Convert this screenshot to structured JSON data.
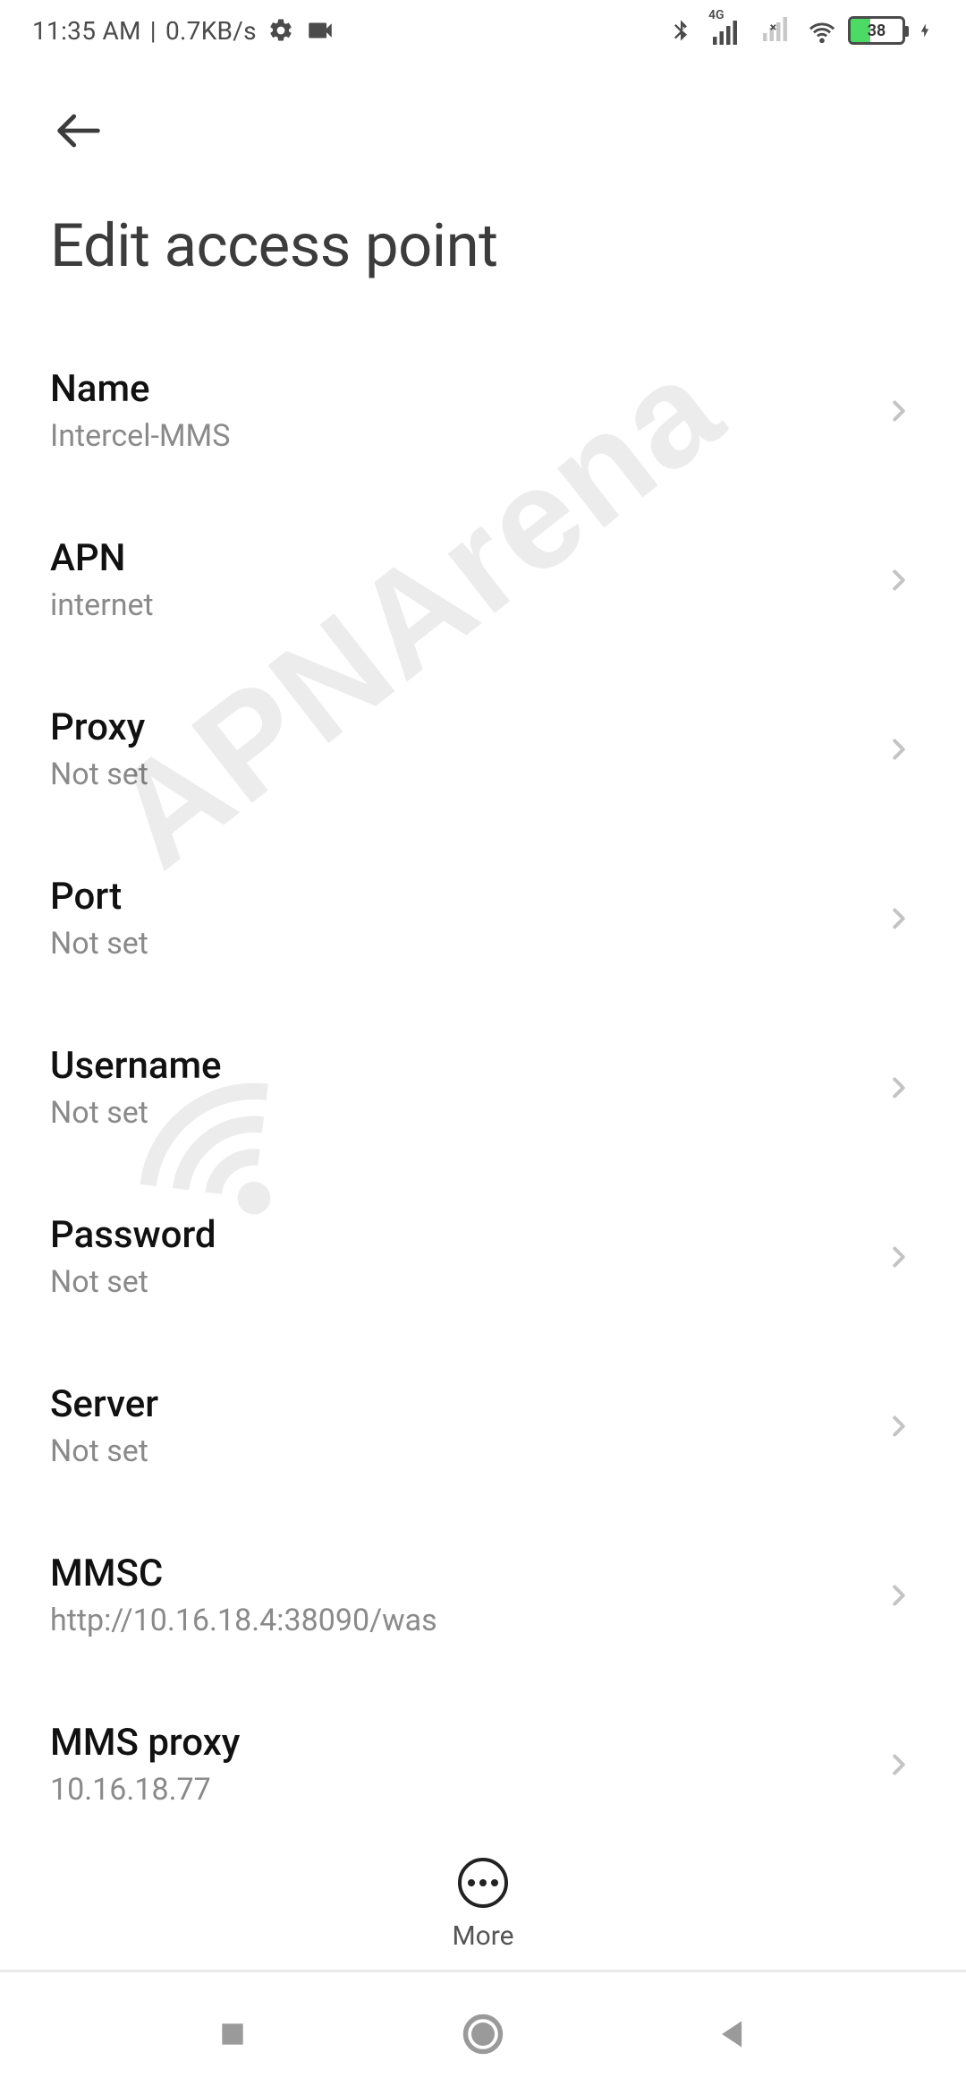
{
  "status": {
    "time": "11:35 AM",
    "net_speed": "0.7KB/s",
    "net_label_4g": "4G",
    "battery_pct": "38"
  },
  "header": {
    "title": "Edit access point"
  },
  "settings": [
    {
      "label": "Name",
      "value": "Intercel-MMS"
    },
    {
      "label": "APN",
      "value": "internet"
    },
    {
      "label": "Proxy",
      "value": "Not set"
    },
    {
      "label": "Port",
      "value": "Not set"
    },
    {
      "label": "Username",
      "value": "Not set"
    },
    {
      "label": "Password",
      "value": "Not set"
    },
    {
      "label": "Server",
      "value": "Not set"
    },
    {
      "label": "MMSC",
      "value": "http://10.16.18.4:38090/was"
    },
    {
      "label": "MMS proxy",
      "value": "10.16.18.77"
    }
  ],
  "footer": {
    "more_label": "More"
  },
  "watermark": {
    "text": "APNArena"
  }
}
